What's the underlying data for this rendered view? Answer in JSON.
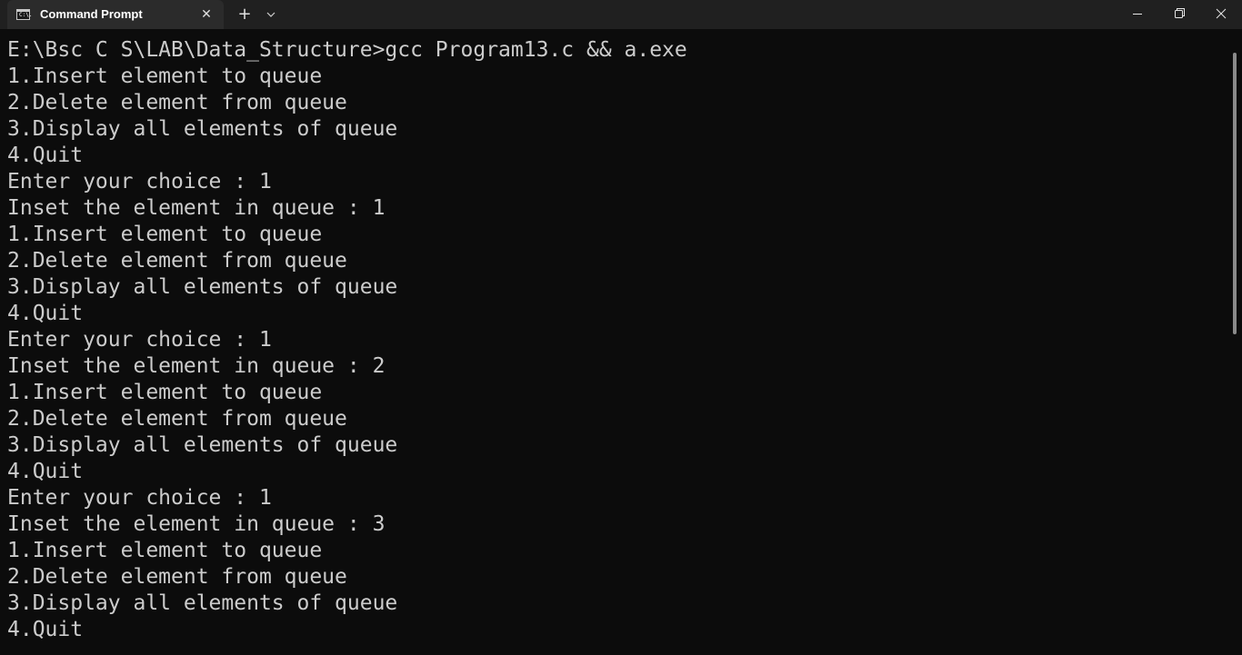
{
  "window": {
    "tab_title": "Command Prompt",
    "tab_icon": "cmd-icon",
    "tab_icon_glyph": "C:\\.",
    "close_tab_glyph": "✕",
    "new_tab_glyph": "+",
    "icons": [
      "cmd-icon",
      "close-icon",
      "plus-icon",
      "chevron-down-icon",
      "minimize-icon",
      "maximize-icon",
      "close-window-icon"
    ]
  },
  "colors": {
    "background": "#0c0c0c",
    "titlebar": "#202020",
    "tab": "#2b2b2b",
    "text": "#cccccc"
  },
  "console": {
    "lines": [
      "E:\\Bsc C S\\LAB\\Data_Structure>gcc Program13.c && a.exe",
      "1.Insert element to queue",
      "2.Delete element from queue",
      "3.Display all elements of queue",
      "4.Quit",
      "Enter your choice : 1",
      "Inset the element in queue : 1",
      "1.Insert element to queue",
      "2.Delete element from queue",
      "3.Display all elements of queue",
      "4.Quit",
      "Enter your choice : 1",
      "Inset the element in queue : 2",
      "1.Insert element to queue",
      "2.Delete element from queue",
      "3.Display all elements of queue",
      "4.Quit",
      "Enter your choice : 1",
      "Inset the element in queue : 3",
      "1.Insert element to queue",
      "2.Delete element from queue",
      "3.Display all elements of queue",
      "4.Quit"
    ]
  }
}
